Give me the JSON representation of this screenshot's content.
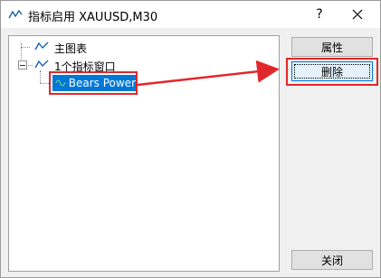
{
  "window": {
    "title": "指标启用 XAUUSD,M30",
    "help_symbol": "?",
    "icons": {
      "title": "indicator-line-icon",
      "close": "close-icon"
    }
  },
  "tree": {
    "items": [
      {
        "label": "主图表",
        "icon": "chart-line-icon",
        "expanded": false
      },
      {
        "label": "1个指标窗口",
        "icon": "chart-line-icon",
        "expanded": true,
        "children": [
          {
            "label": "Bears Power",
            "icon": "indicator-wave-icon",
            "selected": true
          }
        ]
      }
    ]
  },
  "buttons": {
    "properties": "属性",
    "delete": "删除",
    "close": "关闭"
  },
  "colors": {
    "selection": "#0078d7",
    "annotation": "#e0282c",
    "icon_blue": "#1a5fb4",
    "icon_green": "#3a9a3a"
  }
}
